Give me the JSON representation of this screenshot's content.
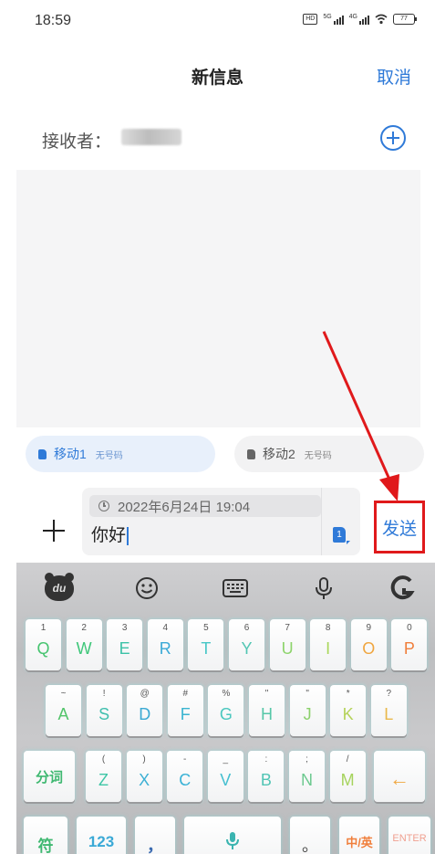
{
  "status_bar": {
    "time": "18:59",
    "hd": "HD",
    "signal1_label": "5G",
    "signal2_label": "4G",
    "battery": "77"
  },
  "header": {
    "title": "新信息",
    "cancel_label": "取消"
  },
  "recipient": {
    "label": "接收者："
  },
  "sim_options": [
    {
      "name": "移动1",
      "note": "无号码",
      "selected": true
    },
    {
      "name": "移动2",
      "note": "无号码",
      "selected": false
    }
  ],
  "compose": {
    "scheduled_time": "2022年6月24日 19:04",
    "text": "你好",
    "sim_badge": "1",
    "send_label": "发送"
  },
  "keyboard": {
    "toolbar_icons": [
      "du-logo-icon",
      "emoji-icon",
      "keyboard-icon",
      "microphone-icon",
      "g-logo-icon"
    ],
    "du_text": "du",
    "row1": [
      {
        "main": "Q",
        "sub": "1",
        "color": "#46c46f"
      },
      {
        "main": "W",
        "sub": "2",
        "color": "#3fc77a"
      },
      {
        "main": "E",
        "sub": "3",
        "color": "#3cc2a7"
      },
      {
        "main": "R",
        "sub": "4",
        "color": "#3aa9d6"
      },
      {
        "main": "T",
        "sub": "5",
        "color": "#47c7c7"
      },
      {
        "main": "Y",
        "sub": "6",
        "color": "#52c6b3"
      },
      {
        "main": "U",
        "sub": "7",
        "color": "#8dd46b"
      },
      {
        "main": "I",
        "sub": "8",
        "color": "#a9d75a"
      },
      {
        "main": "O",
        "sub": "9",
        "color": "#f0a640"
      },
      {
        "main": "P",
        "sub": "0",
        "color": "#f07f3c"
      }
    ],
    "row2": [
      {
        "main": "A",
        "sub": "~",
        "color": "#52c46a"
      },
      {
        "main": "S",
        "sub": "!",
        "color": "#3fbfae"
      },
      {
        "main": "D",
        "sub": "@",
        "color": "#3ba9d3"
      },
      {
        "main": "F",
        "sub": "#",
        "color": "#3ab4d0"
      },
      {
        "main": "G",
        "sub": "%",
        "color": "#4bc7bf"
      },
      {
        "main": "H",
        "sub": "\"",
        "color": "#56c7a8"
      },
      {
        "main": "J",
        "sub": "\"",
        "color": "#8bd06b"
      },
      {
        "main": "K",
        "sub": "*",
        "color": "#b5d35a"
      },
      {
        "main": "L",
        "sub": "?",
        "color": "#e9b84a"
      }
    ],
    "row3": [
      {
        "main": "Z",
        "sub": "(",
        "color": "#3fc6a6"
      },
      {
        "main": "X",
        "sub": ")",
        "color": "#3cb0d4"
      },
      {
        "main": "C",
        "sub": "-",
        "color": "#3ab2d6"
      },
      {
        "main": "V",
        "sub": "_",
        "color": "#45bfd0"
      },
      {
        "main": "B",
        "sub": ":",
        "color": "#52c5b5"
      },
      {
        "main": "N",
        "sub": ";",
        "color": "#6cc98f"
      },
      {
        "main": "M",
        "sub": "/",
        "color": "#a6d35d"
      }
    ],
    "segment_label": "分词",
    "segment_color": "#3fb871",
    "backspace_glyph": "←",
    "backspace_color": "#f0a640",
    "row4": {
      "symbol_label": "符",
      "symbol_color": "#3fb871",
      "num_label": "123",
      "num_color": "#3aa9d6",
      "comma_label": "，",
      "comma_color": "#3a6ab0",
      "period_label": "。",
      "period_color": "#444444",
      "lang_label": "中/英",
      "lang_color": "#f07f3c",
      "enter_label": "ENTER",
      "enter_color": "#f0a090",
      "space_mic_color": "#3ab4b0"
    }
  },
  "colors": {
    "accent": "#2f7ad8",
    "highlight_box": "#e0191b"
  }
}
